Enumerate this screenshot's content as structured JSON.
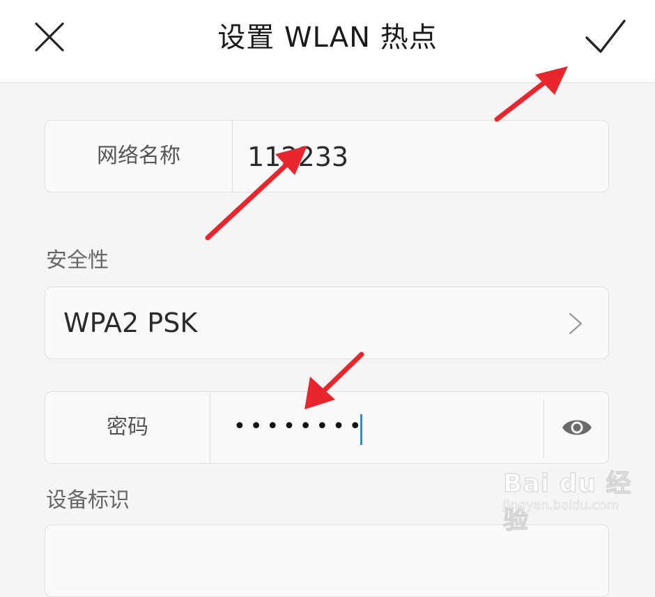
{
  "header": {
    "title": "设置 WLAN 热点",
    "close_icon": "close-icon",
    "confirm_icon": "checkmark-icon"
  },
  "ssid": {
    "label": "网络名称",
    "value": "112233"
  },
  "security": {
    "section_label": "安全性",
    "value": "WPA2 PSK",
    "chevron_icon": "chevron-right-icon"
  },
  "password": {
    "label": "密码",
    "masked_value": "••••••••",
    "visibility_icon": "eye-icon"
  },
  "device": {
    "section_label": "设备标识"
  },
  "watermark": {
    "text": "Bai du 经验",
    "url": "jingyan.baidu.com"
  },
  "colors": {
    "annotation_arrow": "#e8262b",
    "caret": "#2e8ae6",
    "background": "#f5f5f5"
  }
}
